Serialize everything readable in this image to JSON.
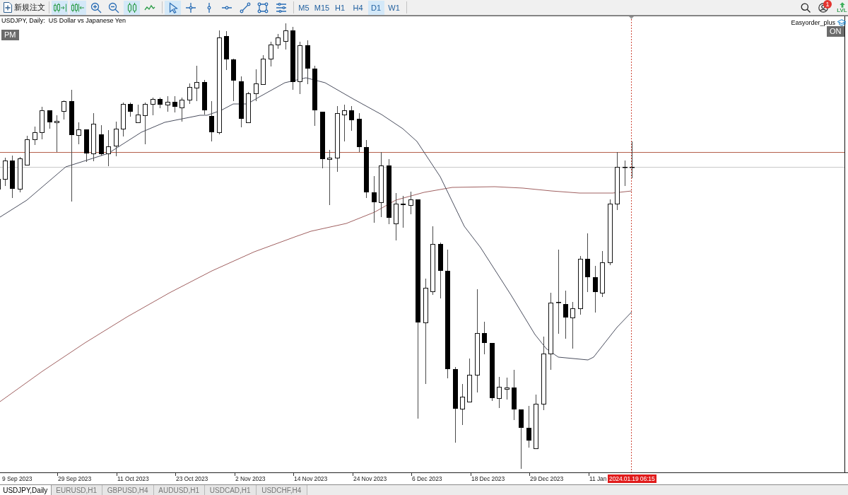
{
  "toolbar": {
    "new_order": "新規注文",
    "chart_buttons": [
      {
        "kind": "autoscroll",
        "selected": true
      },
      {
        "kind": "shift",
        "selected": true
      },
      {
        "kind": "zoomin",
        "selected": false
      },
      {
        "kind": "zoomout",
        "selected": false
      },
      {
        "kind": "candles",
        "selected": true
      },
      {
        "kind": "line",
        "selected": false
      }
    ],
    "drawing_tools": [
      {
        "kind": "cursor",
        "selected": true
      },
      {
        "kind": "crosshair",
        "selected": false
      },
      {
        "kind": "vline",
        "selected": false
      },
      {
        "kind": "hline",
        "selected": false
      },
      {
        "kind": "trendline",
        "selected": false
      },
      {
        "kind": "rectangle",
        "selected": false
      },
      {
        "kind": "objects",
        "selected": false
      }
    ],
    "timeframes": [
      {
        "label": "M5",
        "selected": false
      },
      {
        "label": "M15",
        "selected": false
      },
      {
        "label": "H1",
        "selected": false
      },
      {
        "label": "H4",
        "selected": false
      },
      {
        "label": "D1",
        "selected": true
      },
      {
        "label": "W1",
        "selected": false
      }
    ],
    "notification_count": "1",
    "level_label": "LVL"
  },
  "chart": {
    "title": "USDJPY, Daily:  US Dollar vs Japanese Yen",
    "session_badge": "PM",
    "expert_name": "Easyorder_plus",
    "expert_status": "ON",
    "date_labels": [
      "9 Sep 2023",
      "29 Sep 2023",
      "11 Oct 2023",
      "23 Oct 2023",
      "2 Nov 2023",
      "14 Nov 2023",
      "24 Nov 2023",
      "6 Dec 2023",
      "18 Dec 2023",
      "29 Dec 2023",
      "11 Jan"
    ],
    "cursor_time": "2024.01.19 06:15"
  },
  "tabs": [
    {
      "label": "USDJPY,Daily",
      "selected": true
    },
    {
      "label": "EURUSD,H1",
      "selected": false
    },
    {
      "label": "GBPUSD,H4",
      "selected": false
    },
    {
      "label": "AUDUSD,H1",
      "selected": false
    },
    {
      "label": "USDCAD,H1",
      "selected": false
    },
    {
      "label": "USDCHF,H4",
      "selected": false
    }
  ]
}
